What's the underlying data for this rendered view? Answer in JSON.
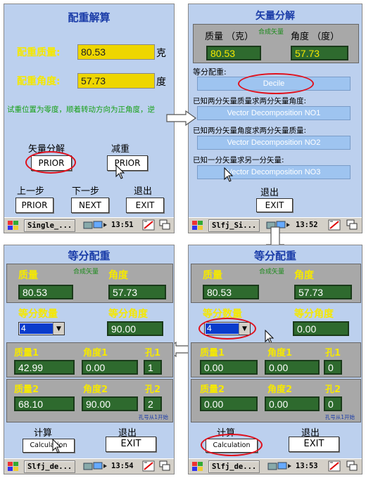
{
  "p1": {
    "title": "配重解算",
    "mass_label": "配重质量:",
    "mass_value": "80.53",
    "mass_unit": "克",
    "angle_label": "配重角度:",
    "angle_value": "57.73",
    "angle_unit": "度",
    "info_text": "试重位置为零度，顺着转动方向为正角度，逆",
    "vector_label": "矢量分解",
    "reduce_label": "减重",
    "prior_btn1": "PRIOR",
    "prior_btn2": "PRIOR",
    "prev_label": "上一步",
    "next_label": "下一步",
    "exit_label": "退出",
    "prior_btn3": "PRIOR",
    "next_btn": "NEXT",
    "exit_btn": "EXIT",
    "taskbar_app": "Single_...",
    "taskbar_time": "13:51"
  },
  "p2": {
    "title": "矢量分解",
    "mass_header": "质量 （克）",
    "synth_label": "合成矢量",
    "angle_header": "角度 （度）",
    "mass_value": "80.53",
    "angle_value": "57.73",
    "equal_label": "等分配重:",
    "equal_btn": "Decile",
    "known1_label": "已知两分矢量质量求两分矢量角度:",
    "known1_btn": "Vector Decomposition NO1",
    "known2_label": "已知两分矢量角度求两分矢量质量:",
    "known2_btn": "Vector Decomposition NO2",
    "known3_label": "已知一分矢量求另一分矢量:",
    "known3_btn": "Vector Decomposition NO3",
    "exit_label": "退出",
    "exit_btn": "EXIT",
    "taskbar_app": "Slfj_Si...",
    "taskbar_time": "13:52"
  },
  "p3": {
    "title": "等分配重",
    "mass_label": "质量",
    "synth_label": "合成矢量",
    "angle_label": "角度",
    "mass_value": "80.53",
    "angle_value": "57.73",
    "count_label": "等分数量",
    "equal_angle_label": "等分角度",
    "count_value": "4",
    "equal_angle_value": "90.00",
    "mass1_label": "质量1",
    "angle1_label": "角度1",
    "hole1_label": "孔1",
    "mass1_value": "42.99",
    "angle1_value": "0.00",
    "hole1_value": "1",
    "mass2_label": "质量2",
    "angle2_label": "角度2",
    "hole2_label": "孔2",
    "mass2_value": "68.10",
    "angle2_value": "90.00",
    "hole2_value": "2",
    "hole_note": "孔号从1开始",
    "calc_label": "计算",
    "exit_label": "退出",
    "calc_btn": "Calculation",
    "exit_btn": "EXIT",
    "taskbar_app": "Slfj_de...",
    "taskbar_time": "13:54"
  },
  "p4": {
    "title": "等分配重",
    "mass_label": "质量",
    "synth_label": "合成矢量",
    "angle_label": "角度",
    "mass_value": "80.53",
    "angle_value": "57.73",
    "count_label": "等分数量",
    "equal_angle_label": "等分角度",
    "count_value": "4",
    "equal_angle_value": "0.00",
    "mass1_label": "质量1",
    "angle1_label": "角度1",
    "hole1_label": "孔1",
    "mass1_value": "0.00",
    "angle1_value": "0.00",
    "hole1_value": "0",
    "mass2_label": "质量2",
    "angle2_label": "角度2",
    "hole2_label": "孔2",
    "mass2_value": "0.00",
    "angle2_value": "0.00",
    "hole2_value": "0",
    "hole_note": "孔号从1开始",
    "calc_label": "计算",
    "exit_label": "退出",
    "calc_btn": "Calculation",
    "exit_btn": "EXIT",
    "taskbar_app": "Slfj_de...",
    "taskbar_time": "13:53"
  },
  "colors": {
    "panel_bg": "#bcd0ee",
    "title_blue": "#1a3ca8",
    "yellow_label": "#f5e800",
    "green_value": "#2e6a2e",
    "highlight_red": "#e0101c"
  }
}
